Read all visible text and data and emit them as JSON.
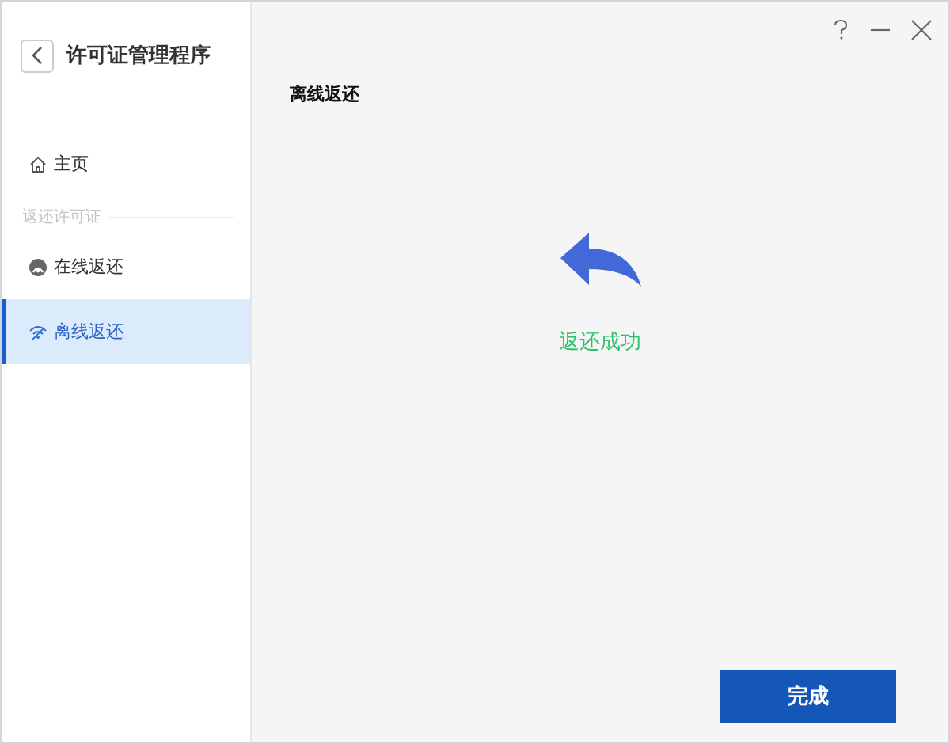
{
  "app_title": "许可证管理程序",
  "nav": [
    {
      "kind": "item",
      "label": "主页",
      "selected": false
    },
    {
      "kind": "section",
      "label": "返还许可证"
    },
    {
      "kind": "item",
      "label": "在线返还",
      "selected": false
    },
    {
      "kind": "item",
      "label": "离线返还",
      "selected": true
    }
  ],
  "page_title": "离线返还",
  "result": {
    "message": "返还成功"
  },
  "finish_button": "完成"
}
